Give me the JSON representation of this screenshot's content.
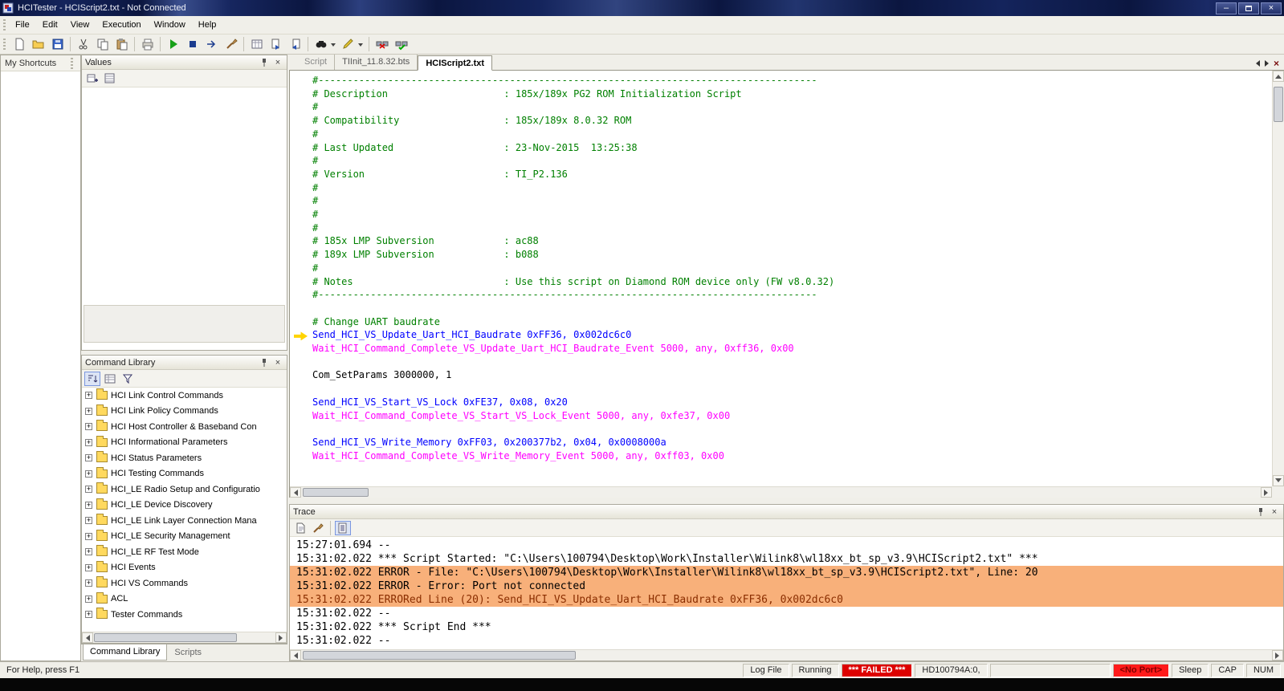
{
  "window": {
    "title": "HCITester - HCIScript2.txt - Not Connected"
  },
  "menu": {
    "items": [
      "File",
      "Edit",
      "View",
      "Execution",
      "Window",
      "Help"
    ]
  },
  "shortcuts": {
    "title": "My Shortcuts"
  },
  "values": {
    "title": "Values"
  },
  "command_library": {
    "title": "Command Library",
    "items": [
      "HCI Link Control Commands",
      "HCI Link Policy Commands",
      "HCI Host Controller & Baseband Con",
      "HCI Informational Parameters",
      "HCI Status Parameters",
      "HCI Testing Commands",
      "HCI_LE Radio Setup and Configuratio",
      "HCI_LE Device Discovery",
      "HCI_LE Link Layer Connection Mana",
      "HCI_LE Security Management",
      "HCI_LE RF Test Mode",
      "HCI Events",
      "HCI VS Commands",
      "ACL",
      "Tester Commands"
    ]
  },
  "left_tabs": [
    {
      "label": "Command Library",
      "active": true
    },
    {
      "label": "Scripts",
      "active": false
    }
  ],
  "editor": {
    "tabs": [
      {
        "label": "Script",
        "active": false,
        "muted": true
      },
      {
        "label": "TIInit_11.8.32.bts",
        "active": false,
        "muted": false
      },
      {
        "label": "HCIScript2.txt",
        "active": true,
        "muted": false
      }
    ],
    "lines": [
      {
        "type": "comment",
        "text": "#--------------------------------------------------------------------------------------"
      },
      {
        "type": "comment",
        "text": "# Description                    : 185x/189x PG2 ROM Initialization Script"
      },
      {
        "type": "comment",
        "text": "#"
      },
      {
        "type": "comment",
        "text": "# Compatibility                  : 185x/189x 8.0.32 ROM"
      },
      {
        "type": "comment",
        "text": "#"
      },
      {
        "type": "comment",
        "text": "# Last Updated                   : 23-Nov-2015  13:25:38"
      },
      {
        "type": "comment",
        "text": "#"
      },
      {
        "type": "comment",
        "text": "# Version                        : TI_P2.136"
      },
      {
        "type": "comment",
        "text": "#"
      },
      {
        "type": "comment",
        "text": "#"
      },
      {
        "type": "comment",
        "text": "#"
      },
      {
        "type": "comment",
        "text": "#"
      },
      {
        "type": "comment",
        "text": "# 185x LMP Subversion            : ac88"
      },
      {
        "type": "comment",
        "text": "# 189x LMP Subversion            : b088"
      },
      {
        "type": "comment",
        "text": "#"
      },
      {
        "type": "comment",
        "text": "# Notes                          : Use this script on Diamond ROM device only (FW v8.0.32)"
      },
      {
        "type": "comment",
        "text": "#--------------------------------------------------------------------------------------"
      },
      {
        "type": "plain",
        "text": ""
      },
      {
        "type": "comment",
        "text": "# Change UART baudrate"
      },
      {
        "type": "cmd",
        "text": "Send_HCI_VS_Update_Uart_HCI_Baudrate 0xFF36, 0x002dc6c0",
        "marker": true
      },
      {
        "type": "wait",
        "text": "Wait_HCI_Command_Complete_VS_Update_Uart_HCI_Baudrate_Event 5000, any, 0xff36, 0x00"
      },
      {
        "type": "plain",
        "text": ""
      },
      {
        "type": "plain",
        "text": "Com_SetParams 3000000, 1"
      },
      {
        "type": "plain",
        "text": ""
      },
      {
        "type": "cmd",
        "text": "Send_HCI_VS_Start_VS_Lock 0xFE37, 0x08, 0x20"
      },
      {
        "type": "wait",
        "text": "Wait_HCI_Command_Complete_VS_Start_VS_Lock_Event 5000, any, 0xfe37, 0x00"
      },
      {
        "type": "plain",
        "text": ""
      },
      {
        "type": "cmd",
        "text": "Send_HCI_VS_Write_Memory 0xFF03, 0x200377b2, 0x04, 0x0008000a"
      },
      {
        "type": "wait",
        "text": "Wait_HCI_Command_Complete_VS_Write_Memory_Event 5000, any, 0xff03, 0x00"
      }
    ]
  },
  "trace": {
    "title": "Trace",
    "lines": [
      {
        "text": "15:27:01.694 --"
      },
      {
        "text": "15:31:02.022 *** Script Started: \"C:\\Users\\100794\\Desktop\\Work\\Installer\\Wilink8\\wl18xx_bt_sp_v3.9\\HCIScript2.txt\" ***"
      },
      {
        "text": "15:31:02.022 ERROR - File: \"C:\\Users\\100794\\Desktop\\Work\\Installer\\Wilink8\\wl18xx_bt_sp_v3.9\\HCIScript2.txt\", Line: 20",
        "error": true
      },
      {
        "text": "15:31:02.022 ERROR - Error: Port not connected",
        "error": true
      },
      {
        "text": "15:31:02.022 ERRORed Line (20): Send_HCI_VS_Update_Uart_HCI_Baudrate 0xFF36, 0x002dc6c0",
        "error": true,
        "tone": "dark"
      },
      {
        "text": "15:31:02.022 --"
      },
      {
        "text": "15:31:02.022 *** Script End ***"
      },
      {
        "text": "15:31:02.022 --"
      }
    ]
  },
  "statusbar": {
    "help": "For Help, press F1",
    "cells": [
      {
        "label": "Log File",
        "name": "log-file"
      },
      {
        "label": "Running",
        "name": "running"
      },
      {
        "label": "*** FAILED ***",
        "name": "failed",
        "style": "failed"
      },
      {
        "label": "HD100794A:0,",
        "name": "device-id"
      },
      {
        "label": "",
        "name": "spacer",
        "style": "spacer"
      },
      {
        "label": "<No Port>",
        "name": "port",
        "style": "noport"
      },
      {
        "label": "Sleep",
        "name": "sleep"
      },
      {
        "label": "CAP",
        "name": "cap"
      },
      {
        "label": "NUM",
        "name": "num"
      }
    ]
  },
  "colors": {
    "comment": "#008000",
    "command": "#0000ff",
    "wait": "#ff00ff",
    "plain": "#000000",
    "error_bg": "#f8b07a",
    "error_fg": "#8b2e00",
    "failed_bg": "#dd0000",
    "noport_bg": "#ff1a1a",
    "noport_fg": "#7e0000"
  }
}
